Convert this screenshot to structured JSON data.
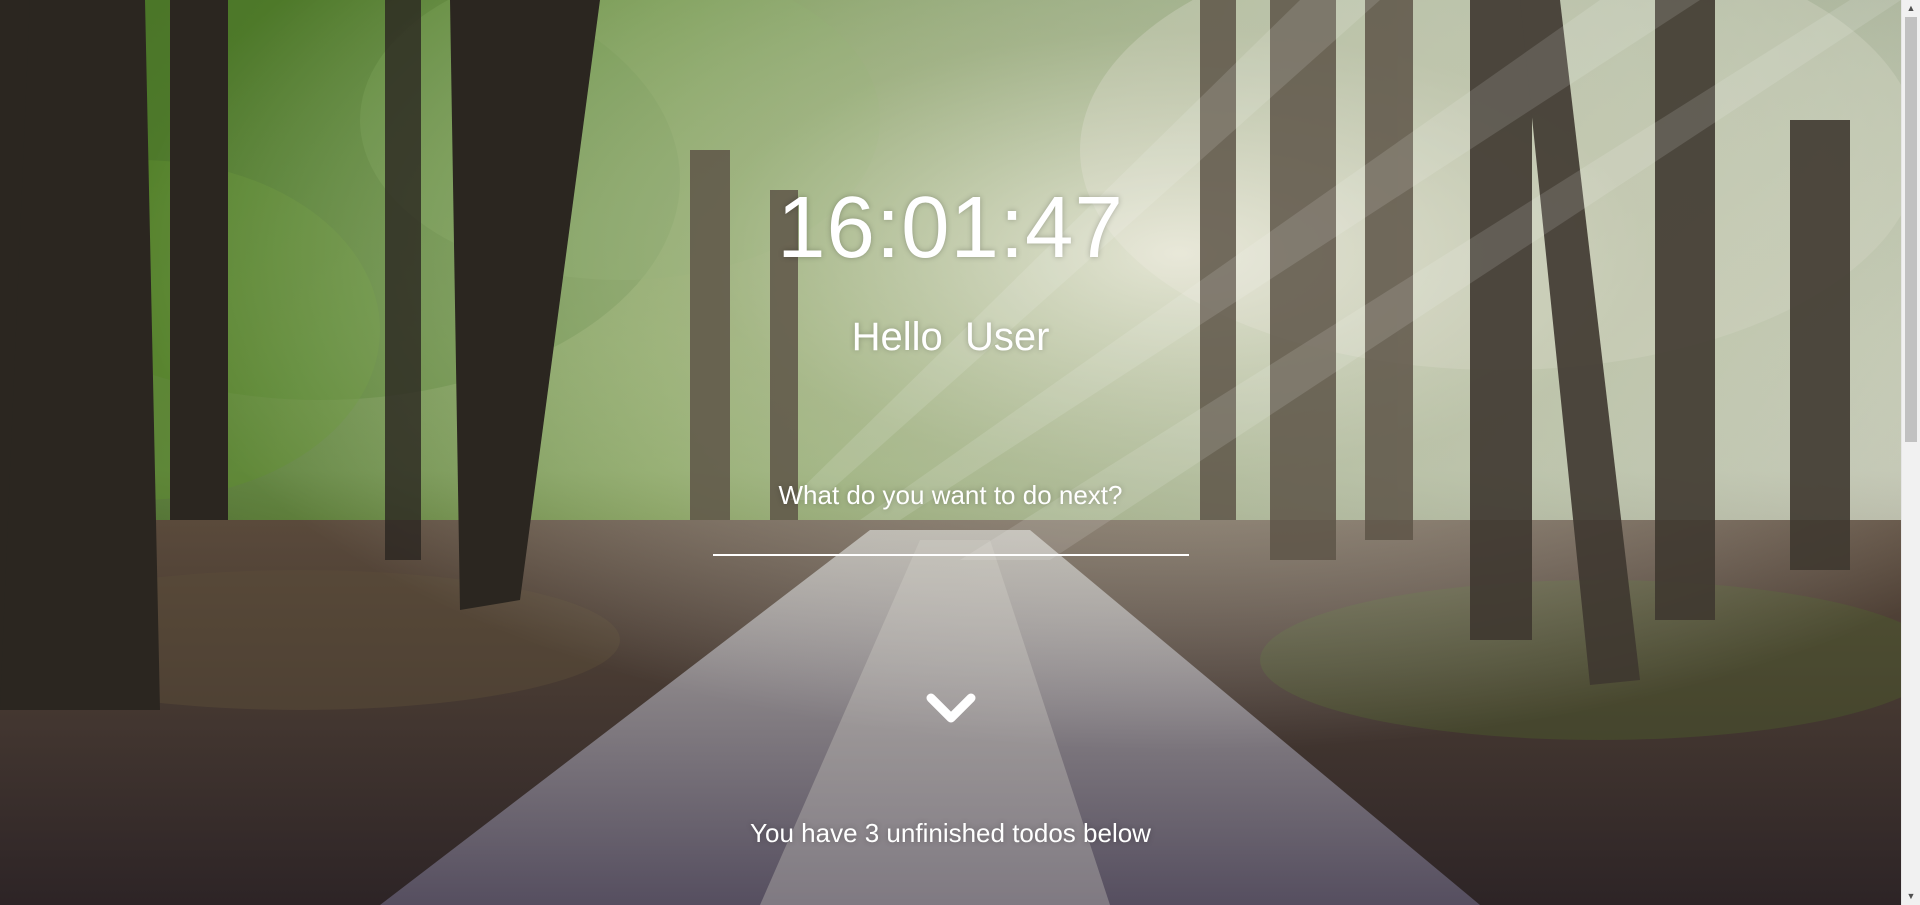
{
  "clock": {
    "time": "16:01:47"
  },
  "greeting": {
    "text": "Hello  User"
  },
  "todo_input": {
    "prompt": "What do you want to do next?",
    "value": ""
  },
  "scroll_down": {
    "icon": "chevron-down-icon"
  },
  "todo_summary": {
    "text": "You have 3 unfinished todos below"
  },
  "background": {
    "description_icon": "forest-path-photo"
  },
  "colors": {
    "text": "#ffffff",
    "input_underline": "#ffffff",
    "scrollbar_track": "#f1f1f1",
    "scrollbar_thumb": "#c1c1c1"
  }
}
